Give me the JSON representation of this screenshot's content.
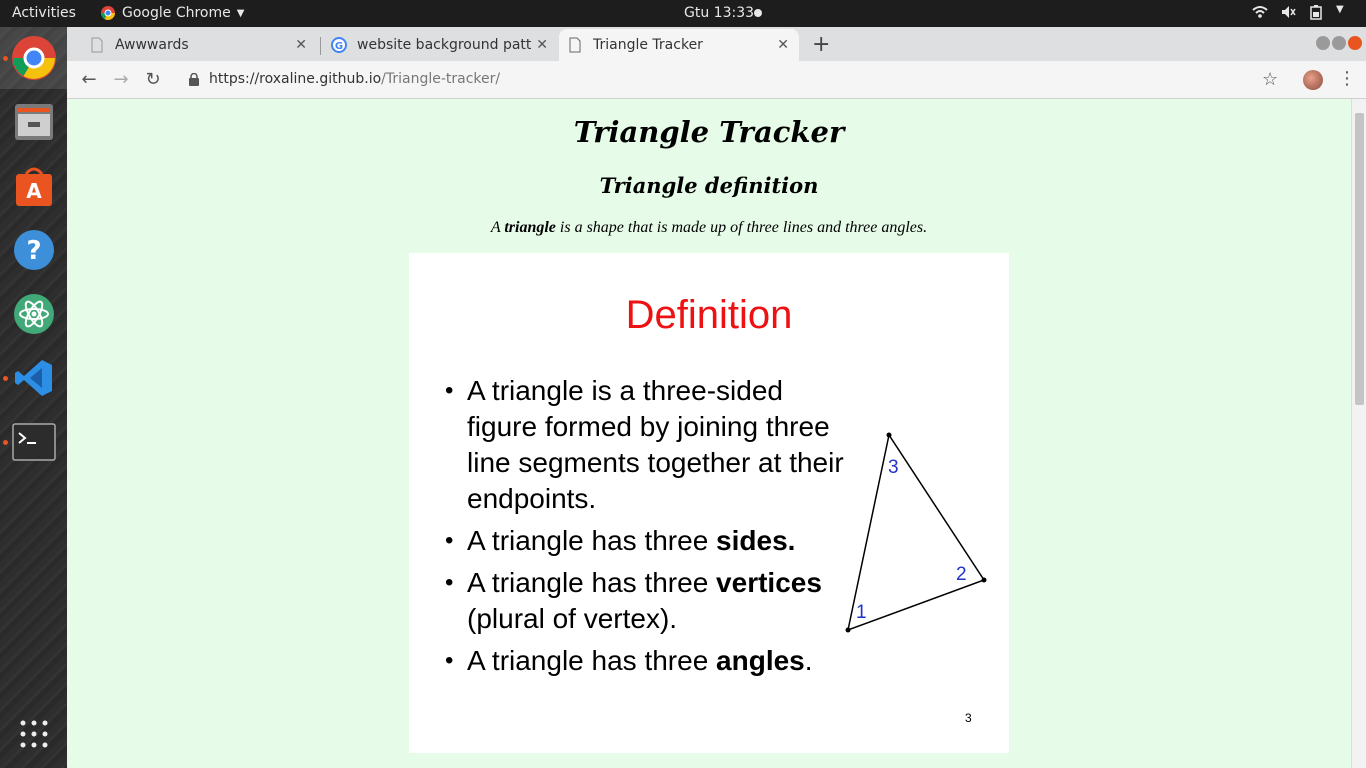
{
  "topbar": {
    "activities": "Activities",
    "app_name": "Google Chrome",
    "clock": "Gtu 13:33"
  },
  "dock": {
    "items": [
      "chrome-icon",
      "files-icon",
      "software-center-icon",
      "help-icon",
      "atom-icon",
      "vscode-icon",
      "terminal-icon",
      "app-grid-icon"
    ]
  },
  "tabs": [
    {
      "title": "Awwwards"
    },
    {
      "title": "website background patt"
    },
    {
      "title": "Triangle Tracker"
    }
  ],
  "address": {
    "host": "https://roxaline.github.io",
    "path": "/Triangle-tracker/"
  },
  "page": {
    "heading": "Triangle Tracker",
    "subheading": "Triangle definition",
    "lead_pre": "A ",
    "lead_bold": "triangle",
    "lead_post": " is a shape that is made up of three lines and three angles."
  },
  "slide": {
    "title": "Definition",
    "bullet1": "A triangle is a three-sided figure formed by joining three line segments together at their endpoints.",
    "bullet2_pre": "A triangle has three ",
    "bullet2_bold": "sides.",
    "bullet3_pre": "A triangle has three ",
    "bullet3_bold": "vertices",
    "bullet3_post": " (plural of vertex).",
    "bullet4_pre": "A triangle has three ",
    "bullet4_bold": "angles",
    "bullet4_post": ".",
    "vertex_labels": [
      "1",
      "2",
      "3"
    ],
    "page_number": "3"
  },
  "colors": {
    "page_bg": "#e6fbe8",
    "slide_title": "#ee1111",
    "vertex_label": "#2233cc"
  }
}
